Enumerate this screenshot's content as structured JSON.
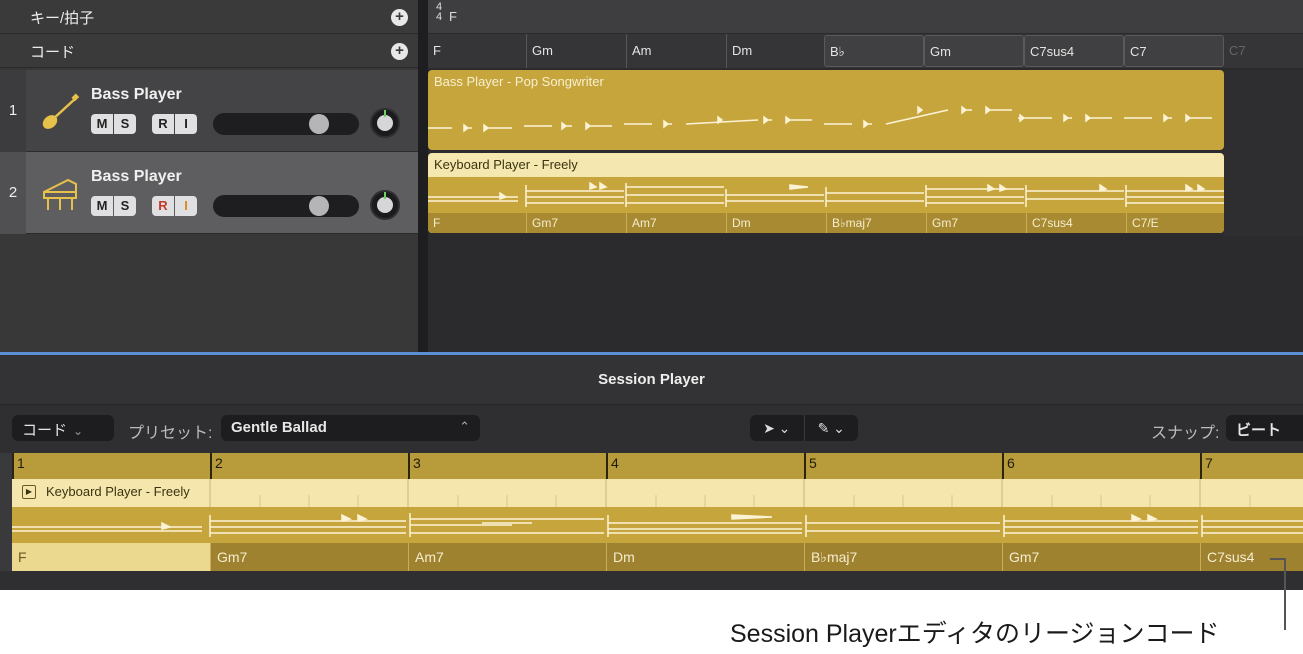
{
  "tracks_area": {
    "global": {
      "key_label": "キー/拍子",
      "chord_label": "コード",
      "time_sig_top": "4",
      "time_sig_bottom": "4",
      "key": "F"
    },
    "chord_track": [
      "F",
      "Gm",
      "Am",
      "Dm",
      "B♭",
      "Gm",
      "C7sus4",
      "C7",
      "C7"
    ],
    "tracks": [
      {
        "number": "1",
        "name": "Bass Player",
        "icon": "bass-guitar-icon",
        "buttons": [
          "M",
          "S",
          "R",
          "I"
        ]
      },
      {
        "number": "2",
        "name": "Bass Player",
        "icon": "piano-icon",
        "buttons": [
          "M",
          "S",
          "R",
          "I"
        ]
      }
    ],
    "regions": {
      "bass": {
        "title": "Bass Player - Pop Songwriter"
      },
      "keyboard": {
        "title": "Keyboard Player - Freely",
        "chords": [
          "F",
          "Gm7",
          "Am7",
          "Dm",
          "B♭maj7",
          "Gm7",
          "C7sus4",
          "C7/E"
        ]
      }
    }
  },
  "editor": {
    "title": "Session Player",
    "mode": "コード",
    "preset_label": "プリセット:",
    "preset": "Gentle Ballad",
    "snap_label": "スナップ:",
    "snap": "ビート",
    "bars": [
      "1",
      "2",
      "3",
      "4",
      "5",
      "6",
      "7"
    ],
    "region_name": "Keyboard Player - Freely",
    "chords": [
      "F",
      "Gm7",
      "Am7",
      "Dm",
      "B♭maj7",
      "Gm7",
      "C7sus4"
    ]
  },
  "callout": "Session Playerエディタのリージョンコード",
  "colors": {
    "region_gold": "#c6a53c",
    "region_light": "#f5e6ad",
    "selection_blue": "#5b8fd6"
  }
}
